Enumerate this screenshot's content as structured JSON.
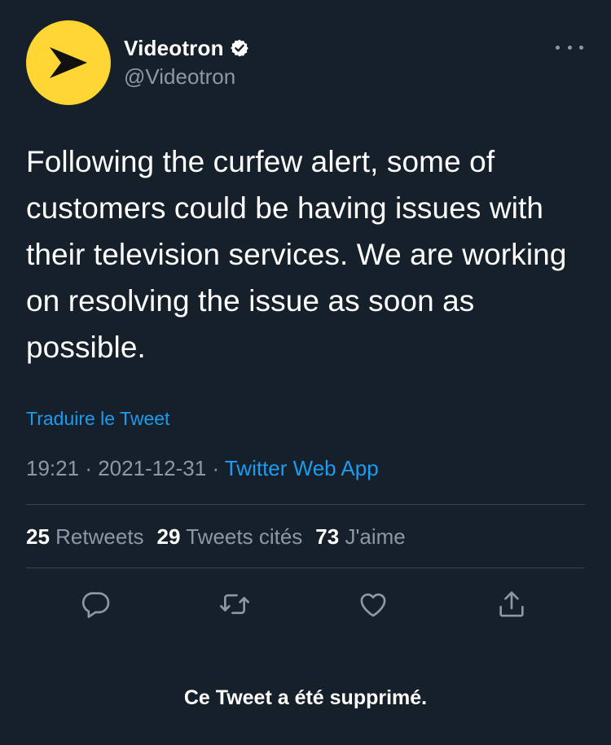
{
  "author": {
    "display_name": "Videotron",
    "handle": "@Videotron",
    "verified": true,
    "avatar_color": "#ffd633"
  },
  "tweet": {
    "text": "Following the curfew alert, some of customers could be having issues with their television services. We are working on resolving the issue as soon as possible.",
    "translate_label": "Traduire le Tweet",
    "time": "19:21",
    "date": "2021-12-31",
    "separator": "·",
    "source": "Twitter Web App"
  },
  "stats": {
    "retweets_count": "25",
    "retweets_label": "Retweets",
    "quotes_count": "29",
    "quotes_label": "Tweets cités",
    "likes_count": "73",
    "likes_label": "J'aime"
  },
  "actions": [
    {
      "name": "reply",
      "icon": "reply-icon"
    },
    {
      "name": "retweet",
      "icon": "retweet-icon"
    },
    {
      "name": "like",
      "icon": "heart-icon"
    },
    {
      "name": "share",
      "icon": "share-icon"
    }
  ],
  "footer": {
    "deleted_notice": "Ce Tweet a été supprimé."
  },
  "colors": {
    "background": "#15202b",
    "text_primary": "#ffffff",
    "text_secondary": "#8b98a5",
    "link": "#1d9bf0",
    "divider": "#38444d"
  }
}
